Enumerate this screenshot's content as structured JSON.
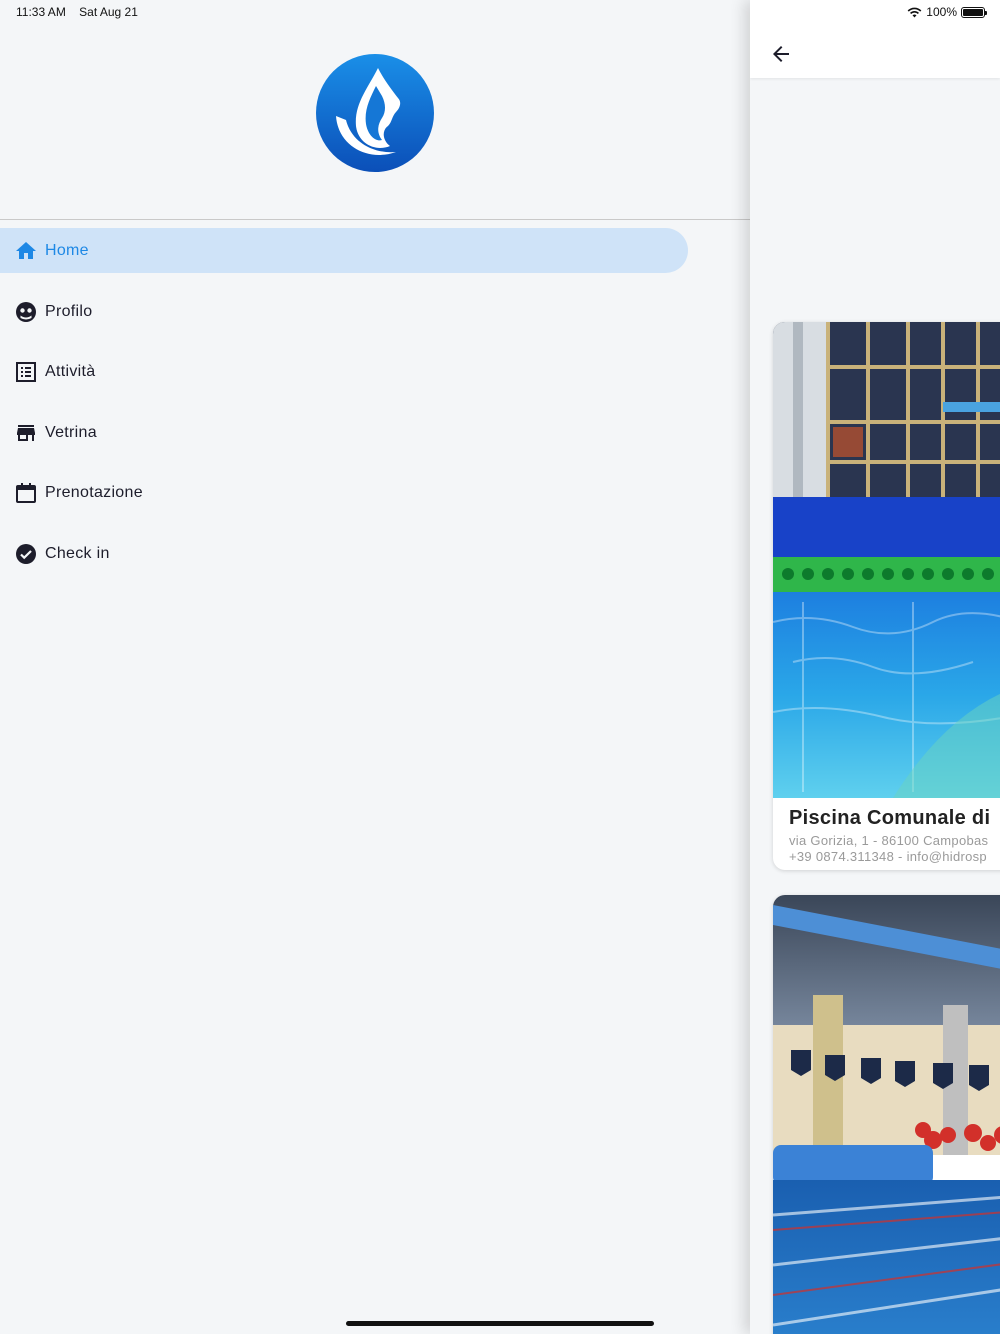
{
  "status_bar": {
    "time": "11:33 AM",
    "date": "Sat Aug 21",
    "battery": "100%",
    "icons": [
      "wifi-icon",
      "battery-icon"
    ]
  },
  "drawer": {
    "logo": "app-logo-water-drop",
    "items": [
      {
        "label": "Home",
        "icon": "home-icon",
        "active": true
      },
      {
        "label": "Profilo",
        "icon": "face-icon",
        "active": false
      },
      {
        "label": "Attività",
        "icon": "list-icon",
        "active": false
      },
      {
        "label": "Vetrina",
        "icon": "store-icon",
        "active": false
      },
      {
        "label": "Prenotazione",
        "icon": "calendar-icon",
        "active": false
      },
      {
        "label": "Check in",
        "icon": "check-circle-icon",
        "active": false
      }
    ]
  },
  "content": {
    "back_icon": "arrow-back-icon",
    "cards": [
      {
        "title": "Piscina Comunale di",
        "address": "via Gorizia, 1 - 86100 Campobas",
        "contact": "+39 0874.311348 - info@hidrosp",
        "image": "outdoor-pool-photo"
      },
      {
        "image": "indoor-pool-photo"
      }
    ]
  },
  "colors": {
    "accent": "#1e88e5",
    "active_bg": "#cfe3f8",
    "background": "#f4f6f8"
  }
}
